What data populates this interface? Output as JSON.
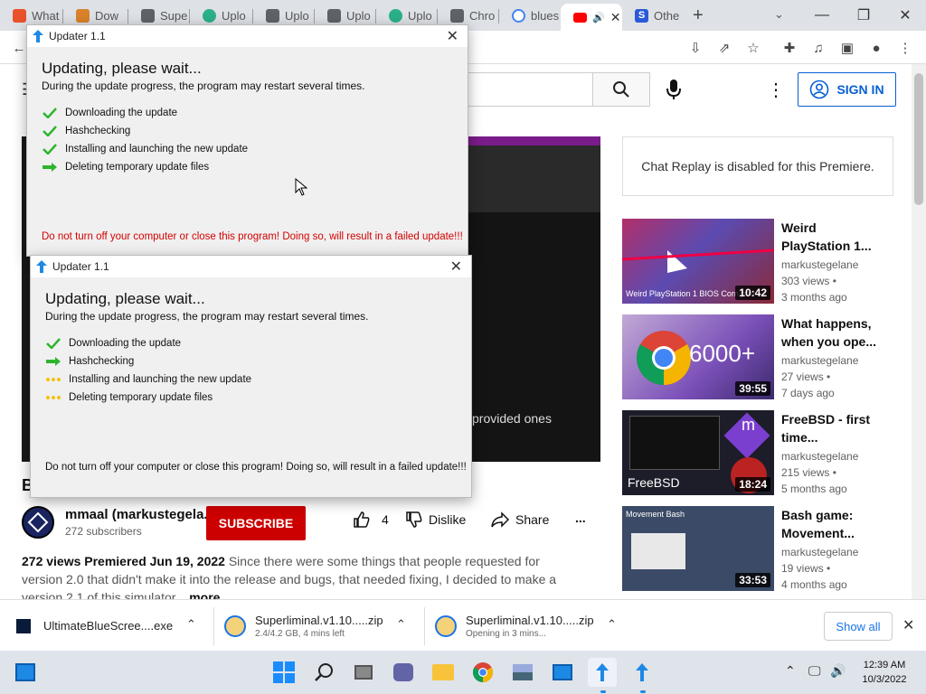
{
  "browser": {
    "tabs": [
      {
        "label": "What",
        "fav_color": "#e8532b"
      },
      {
        "label": "Dow",
        "fav_color": "#d9822b"
      },
      {
        "label": "Supe",
        "fav_color": "#5f6368"
      },
      {
        "label": "Uplo",
        "fav_color": "#2bb08a"
      },
      {
        "label": "Uplo",
        "fav_color": "#5f6368"
      },
      {
        "label": "Uplo",
        "fav_color": "#5f6368"
      },
      {
        "label": "Uplo",
        "fav_color": "#2bb08a"
      },
      {
        "label": "Chro",
        "fav_color": "#5f6368"
      },
      {
        "label": "blues",
        "fav_color": "#4285f4"
      },
      {
        "label": "",
        "fav_color": "#ff0000"
      },
      {
        "label": "Othe",
        "fav_color": "#2a5bd7"
      }
    ],
    "new_tab": "+",
    "window": {
      "minimize": "—",
      "restore": "❐",
      "close": "✕"
    }
  },
  "youtube": {
    "signin_label": "SIGN IN",
    "chat_replay": "Chat Replay is disabled for this Premiere.",
    "player_overlay_text": "provided ones",
    "channel_name": "mmaal (markustegela...",
    "subscribers": "272 subscribers",
    "subscribe_label": "SUBSCRIBE",
    "likes": "4",
    "dislike_label": "Dislike",
    "share_label": "Share",
    "more_dots": "...",
    "title_initial": "B",
    "description": {
      "stats": "272 views  Premiered Jun 19, 2022",
      "text": "Since there were some things that people requested for version 2.0 that didn't make it into the release and bugs, that needed fixing, I decided to make a version 2.1 of this simulator...",
      "more_label": "more"
    },
    "recommended": [
      {
        "title": "Weird PlayStation 1...",
        "channel": "markustegelane",
        "views": "303 views •",
        "age": "3 months ago",
        "duration": "10:42",
        "thumb_caption": "Weird PlayStation 1 BIOS Corruptio"
      },
      {
        "title": "What happens, when you ope...",
        "channel": "markustegelane",
        "views": "27 views •",
        "age": "7 days ago",
        "duration": "39:55",
        "thumb_caption": "6000+"
      },
      {
        "title": "FreeBSD - first time...",
        "channel": "markustegelane",
        "views": "215 views •",
        "age": "5 months ago",
        "duration": "18:24",
        "thumb_caption": "FreeBSD"
      },
      {
        "title": "Bash game: Movement...",
        "channel": "markustegelane",
        "views": "19 views •",
        "age": "4 months ago",
        "duration": "33:53",
        "thumb_caption": "Movement Bash"
      }
    ]
  },
  "updater_back": {
    "title": "Updater 1.1",
    "heading": "Updating, please wait...",
    "sub": "During the update progress, the program may restart several times.",
    "steps": [
      {
        "label": "Downloading the update",
        "status": "done"
      },
      {
        "label": "Hashchecking",
        "status": "done"
      },
      {
        "label": "Installing and launching the new update",
        "status": "done"
      },
      {
        "label": "Deleting temporary update files",
        "status": "current"
      }
    ],
    "warning": "Do not turn off your computer or close this program! Doing so, will result in a failed update!!!",
    "warning_color": "#d40000"
  },
  "updater_front": {
    "title": "Updater 1.1",
    "heading": "Updating, please wait...",
    "sub": "During the update progress, the program may restart several times.",
    "steps": [
      {
        "label": "Downloading the update",
        "status": "done"
      },
      {
        "label": "Hashchecking",
        "status": "current"
      },
      {
        "label": "Installing and launching the new update",
        "status": "pending"
      },
      {
        "label": "Deleting temporary update files",
        "status": "pending"
      }
    ],
    "warning": "Do not turn off your computer or close this program! Doing so, will result in a failed update!!!",
    "warning_color": "#111111"
  },
  "downloads": {
    "items": [
      {
        "name": "UltimateBlueScree....exe",
        "sub": ""
      },
      {
        "name": "Superliminal.v1.10.....zip",
        "sub": "2.4/4.2 GB, 4 mins left"
      },
      {
        "name": "Superliminal.v1.10.....zip",
        "sub": "Opening in 3 mins..."
      }
    ],
    "show_all": "Show all"
  },
  "taskbar": {
    "time": "12:39 AM",
    "date": "10/3/2022"
  }
}
